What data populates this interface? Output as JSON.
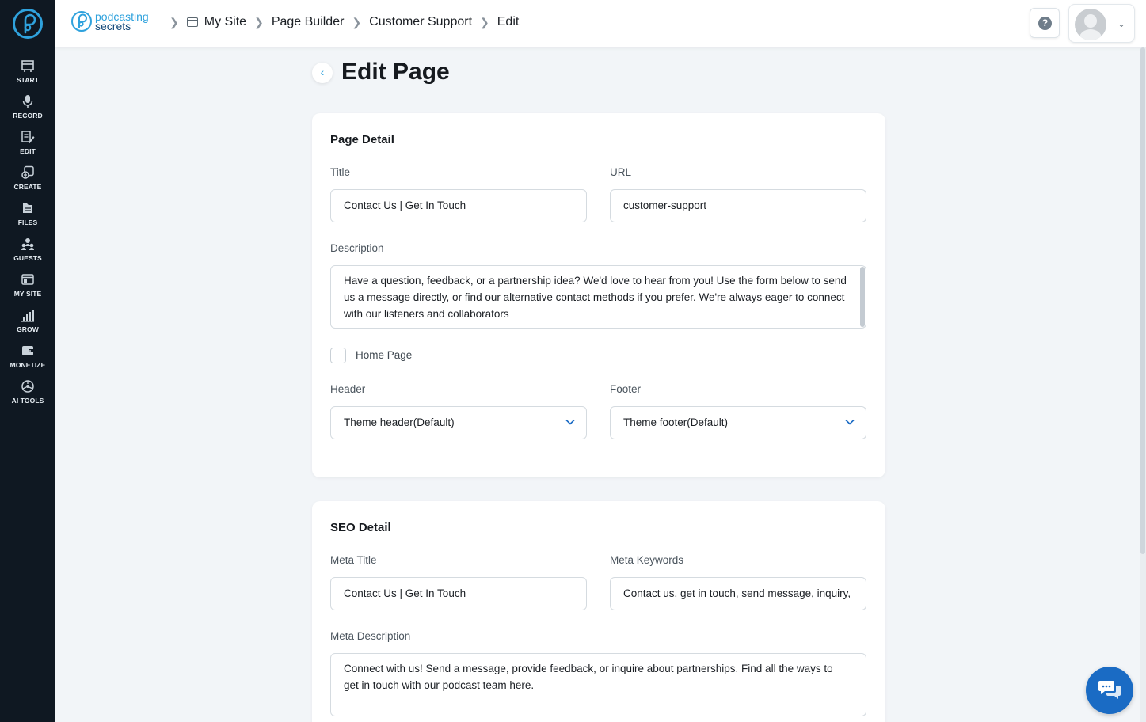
{
  "sidebar": {
    "items": [
      {
        "label": "START",
        "icon": "start-icon"
      },
      {
        "label": "RECORD",
        "icon": "microphone-icon"
      },
      {
        "label": "EDIT",
        "icon": "edit-icon"
      },
      {
        "label": "CREATE",
        "icon": "create-icon"
      },
      {
        "label": "FILES",
        "icon": "files-icon"
      },
      {
        "label": "GUESTS",
        "icon": "guests-icon"
      },
      {
        "label": "MY SITE",
        "icon": "my-site-icon"
      },
      {
        "label": "GROW",
        "icon": "grow-icon"
      },
      {
        "label": "MONETIZE",
        "icon": "monetize-icon"
      },
      {
        "label": "AI TOOLS",
        "icon": "ai-tools-icon"
      }
    ]
  },
  "header": {
    "brand_line1": "podcasting",
    "brand_line2": "secrets",
    "breadcrumbs": [
      "My Site",
      "Page Builder",
      "Customer Support",
      "Edit"
    ],
    "help_label": "?"
  },
  "page": {
    "title": "Edit Page"
  },
  "page_detail": {
    "heading": "Page Detail",
    "title_label": "Title",
    "title_value": "Contact Us | Get In Touch",
    "url_label": "URL",
    "url_value": "customer-support",
    "description_label": "Description",
    "description_value": "Have a question, feedback, or a partnership idea? We'd love to hear from you! Use the form below to send us a message directly, or find our alternative contact methods if you prefer. We're always eager to connect with our listeners and collaborators",
    "home_page_label": "Home Page",
    "home_page_checked": false,
    "header_label": "Header",
    "header_value": "Theme header(Default)",
    "footer_label": "Footer",
    "footer_value": "Theme footer(Default)"
  },
  "seo_detail": {
    "heading": "SEO Detail",
    "meta_title_label": "Meta Title",
    "meta_title_value": "Contact Us | Get In Touch",
    "meta_keywords_label": "Meta Keywords",
    "meta_keywords_value": "Contact us, get in touch, send message, inquiry,",
    "meta_description_label": "Meta Description",
    "meta_description_value": "Connect with us! Send a message, provide feedback, or inquire about partnerships. Find all the ways to get in touch with our podcast team here."
  },
  "colors": {
    "sidebar_bg": "#0f1822",
    "accent": "#2fa2dd",
    "brand_dark": "#14497a",
    "chat_button": "#1a6bc4",
    "page_bg": "#f2f5f8"
  }
}
